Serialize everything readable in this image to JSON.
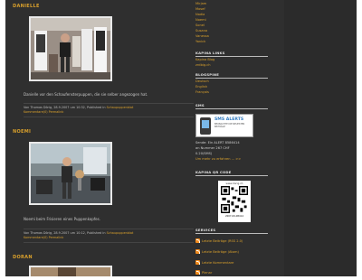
{
  "posts": [
    {
      "title": "DANIELLE",
      "text": "Danielle vor den Schaufensterpuppen, die sie selber angezogen hat.",
      "meta_prefix": "Von Thomas Dörig, 28.9.2007 um 10:32, Published in",
      "category": "Schaupuppenblat",
      "comments": "Kommentare(0) Permalink"
    },
    {
      "title": "NOEMI",
      "text": "Noemi beim Frisieren eines Puppenkopfes.",
      "meta_prefix": "Von Thomas Dörig, 28.9.2007 um 10:12, Published in",
      "category": "Schaupuppenblat",
      "comments": "Kommentare(0) Permalink"
    },
    {
      "title": "DORAN",
      "text": "",
      "meta_prefix": "",
      "category": "",
      "comments": ""
    }
  ],
  "sidebar": {
    "top_links": [
      "Mirjam",
      "Mosef",
      "Nadia",
      "Noemi",
      "Sonel",
      "Susana",
      "Vanessa",
      "Yanick"
    ],
    "links_heading": "KAPINA LINKS",
    "links": [
      "Kapina Blog",
      "zrdbig.ch"
    ],
    "lang_heading": "BLOGSPINE",
    "languages": [
      "Deutsch",
      "English",
      "Français"
    ],
    "sms_heading": "SMS",
    "sms_banner_title": "SMS ALERTS",
    "sms_banner_sub": "BEOBACHTE DIE NEUESTEN BEITRÄGE",
    "sms_text_1": "Sende: Ein ALERT 8586414",
    "sms_text_2": "an Nummer 267 CHF",
    "sms_text_3": "0.20/SMS)",
    "sms_more": "Um mehr zu erfahren ... >>",
    "qr_heading": "KAPINA QR CODE",
    "qr_top": "www.dorig.ch",
    "qr_bottom": "2007-09-08414",
    "services_heading": "SERVICES",
    "feeds": [
      "Letzte Beiträge (RSS 2.0)",
      "Letzte Beiträge (Atom)",
      "Letzte Kommentare",
      "Plenar"
    ]
  },
  "colors": {
    "accent": "#d9a02c",
    "background": "#2f2f2f",
    "feed": "#f08a1c"
  }
}
